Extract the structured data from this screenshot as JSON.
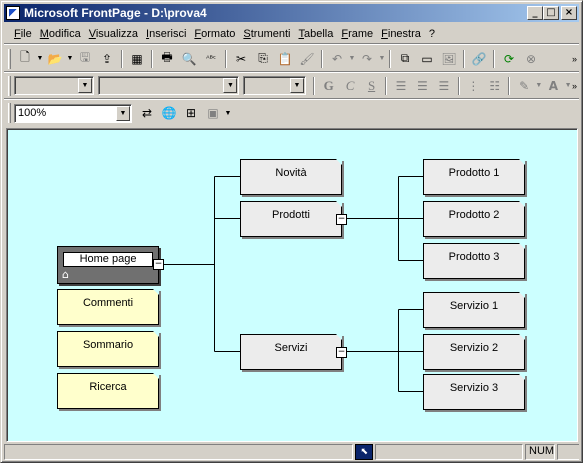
{
  "window": {
    "title": "Microsoft FrontPage - D:\\prova4",
    "minimize": "_",
    "maximize": "□",
    "close": "×"
  },
  "menu": [
    "File",
    "Modifica",
    "Visualizza",
    "Inserisci",
    "Formato",
    "Strumenti",
    "Tabella",
    "Frame",
    "Finestra",
    "?"
  ],
  "toolbar_standard": {
    "icons": [
      "new-page-icon",
      "open-icon",
      "save-icon",
      "publish-icon",
      "folder-list-icon",
      "print-icon",
      "print-preview-icon",
      "spelling-icon",
      "cut-icon",
      "copy-icon",
      "paste-icon",
      "format-painter-icon",
      "undo-icon",
      "redo-icon",
      "components-icon",
      "table-icon",
      "image-icon",
      "hyperlink-icon",
      "refresh-icon",
      "stop-icon"
    ],
    "glyphs": [
      "🗋",
      "📂",
      "🖫",
      "⇪",
      "▦",
      "🖶",
      "🔍",
      "ᴬᴮᶜ",
      "✂",
      "⎘",
      "📋",
      "🖌",
      "↶",
      "↷",
      "⧉",
      "▭",
      "🖼",
      "🔗",
      "⟳",
      "⊗"
    ]
  },
  "toolbar_format": {
    "style_value": "",
    "font_value": "",
    "size_value": "",
    "bold": "G",
    "italic": "C",
    "underline": "S"
  },
  "toolbar_navigation": {
    "zoom_value": "100%",
    "icons": [
      "portrait-landscape-icon",
      "view-subtree-icon",
      "add-existing-page-icon",
      "included-in-navigation-icon"
    ]
  },
  "navigation": {
    "home": "Home page",
    "top_level": [
      "Commenti",
      "Sommario",
      "Ricerca"
    ],
    "sections": [
      "Novità",
      "Prodotti",
      "Servizi"
    ],
    "prodotti_children": [
      "Prodotto 1",
      "Prodotto 2",
      "Prodotto 3"
    ],
    "servizi_children": [
      "Servizio 1",
      "Servizio 2",
      "Servizio 3"
    ],
    "expand_symbol": "−"
  },
  "status": {
    "mode": "NUM"
  }
}
